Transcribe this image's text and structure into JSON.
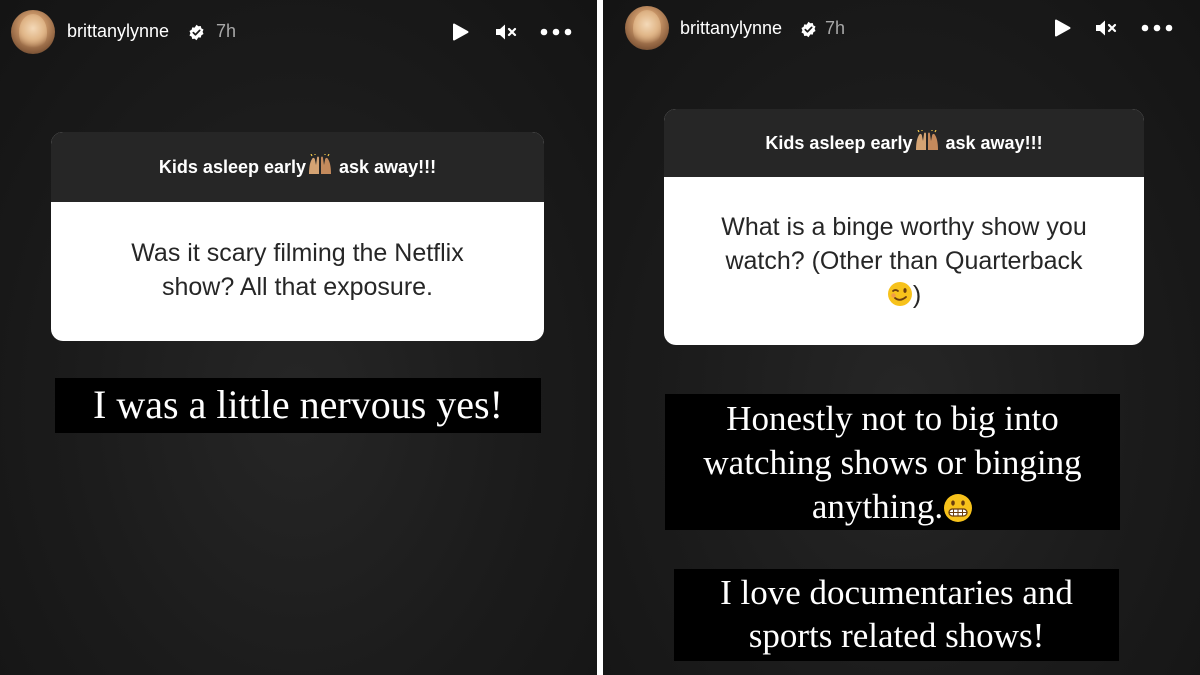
{
  "stories": [
    {
      "username": "brittanylynne",
      "timestamp": "7h",
      "question_prompt_before": "Kids asleep early",
      "question_prompt_after": " ask away!!!",
      "question_text": "Was it scary filming the Netflix show? All that exposure.",
      "answers": [
        "I was a little nervous yes!"
      ]
    },
    {
      "username": "brittanylynne",
      "timestamp": "7h",
      "question_prompt_before": "Kids asleep early",
      "question_prompt_after": " ask away!!!",
      "question_text": "What is a binge worthy show you watch? (Other than Quarterback",
      "question_text_tail": ")",
      "answers": [
        "Honestly not to big into watching shows or binging anything.",
        "I love documentaries and sports related shows!"
      ]
    }
  ],
  "icons": {
    "verified": "verified-badge-icon",
    "play": "play-icon",
    "mute": "mute-icon",
    "more": "more-icon",
    "raised_hands": "raised-hands-emoji-icon",
    "wink": "winking-face-emoji-icon",
    "grimace": "grimacing-face-emoji-icon"
  },
  "colors": {
    "background": "#1c1c1c",
    "card_header": "#262626",
    "card_body": "#ffffff",
    "answer_bg": "#000000",
    "verified": "#ffffff",
    "timestamp": "#a8a8a8"
  }
}
